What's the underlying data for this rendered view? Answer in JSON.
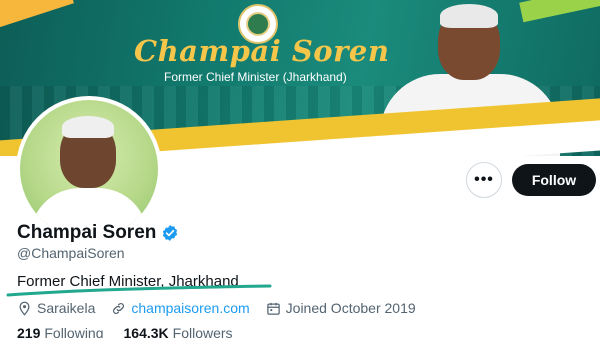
{
  "banner": {
    "title": "Champai Soren",
    "subtitle": "Former Chief Minister (Jharkhand)"
  },
  "profile": {
    "display_name": "Champai Soren",
    "handle": "@ChampaiSoren",
    "bio": "Former Chief Minister, Jharkhand",
    "location": "Saraikela",
    "website": "champaisoren.com",
    "joined": "Joined October 2019"
  },
  "actions": {
    "more_label": "•••",
    "follow_label": "Follow"
  },
  "stats": {
    "following_count": "219",
    "following_label": "Following",
    "followers_count": "164.3K",
    "followers_label": "Followers"
  },
  "colors": {
    "banner_teal": "#127a6e",
    "banner_gold": "#f6c64a",
    "verified_blue": "#1d9bf0",
    "link_blue": "#1d9bf0",
    "follow_bg": "#0f1419",
    "annotation_green": "#22a88e"
  },
  "icons": {
    "verified": "verified-badge-icon",
    "location": "location-pin-icon",
    "link": "link-icon",
    "calendar": "calendar-icon",
    "more": "more-horizontal-icon"
  }
}
